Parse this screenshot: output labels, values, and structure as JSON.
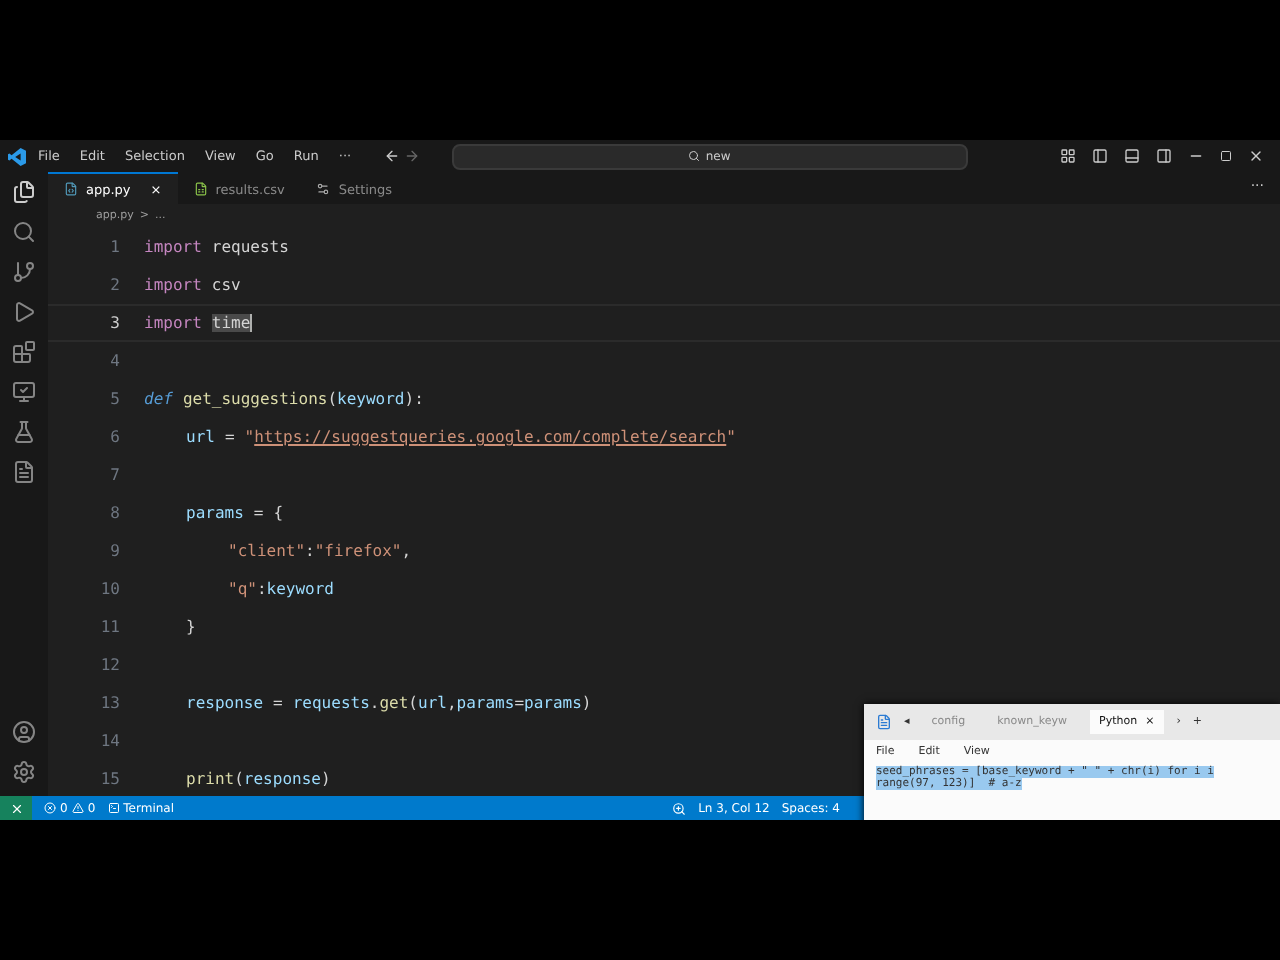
{
  "menu": [
    "File",
    "Edit",
    "Selection",
    "View",
    "Go",
    "Run",
    "···"
  ],
  "command_center": {
    "value": "new"
  },
  "tabs": [
    {
      "label": "app.py",
      "selected": true,
      "kind": "python",
      "close": "×"
    },
    {
      "label": "results.csv",
      "selected": false,
      "kind": "csv"
    },
    {
      "label": "Settings",
      "selected": false,
      "kind": "settings"
    }
  ],
  "editor_more": "···",
  "breadcrumb": [
    "app.py",
    ">",
    "..."
  ],
  "code": [
    {
      "number": "1",
      "current": false,
      "tokens": [
        {
          "kind": "kw",
          "t": "import"
        },
        {
          "kind": "plain",
          "t": "requests"
        }
      ]
    },
    {
      "number": "2",
      "current": false,
      "tokens": [
        {
          "kind": "kw",
          "t": "import"
        },
        {
          "kind": "plain",
          "t": "csv"
        }
      ]
    },
    {
      "number": "3",
      "current": true,
      "tokens": [
        {
          "kind": "kw",
          "t": "import"
        },
        {
          "kind": "match",
          "t": "time"
        }
      ]
    },
    {
      "number": "4",
      "current": false
    },
    {
      "number": "5",
      "current": false,
      "tokens": [
        {
          "kind": "def",
          "t": "def"
        },
        {
          "kind": "fn",
          "t": "get_suggestions"
        },
        {
          "kind": "glue",
          "t": "("
        },
        {
          "kind": "var",
          "t": "keyword"
        },
        {
          "kind": "glue",
          "t": "):"
        }
      ],
      "children": [
        {
          "number": "6",
          "current": false,
          "tokens": [
            {
              "kind": "var",
              "t": "url"
            },
            {
              "kind": "plain",
              "t": "="
            },
            {
              "kind": "str",
              "t": "\""
            },
            {
              "kind": "url",
              "t": "https://suggestqueries.google.com/complete/search"
            },
            {
              "kind": "str",
              "t": "\""
            }
          ]
        },
        {
          "number": "7",
          "current": false
        },
        {
          "number": "8",
          "current": false,
          "tokens": [
            {
              "kind": "var",
              "t": "params"
            },
            {
              "kind": "plain",
              "t": "="
            },
            {
              "kind": "plain",
              "t": "{"
            }
          ],
          "children": [
            {
              "number": "9",
              "current": false,
              "tokens": [
                {
                  "kind": "str",
                  "t": "\"client\""
                },
                {
                  "kind": "glue",
                  "t": ":"
                },
                {
                  "kind": "str",
                  "t": "\"firefox\""
                },
                {
                  "kind": "glue",
                  "t": ","
                }
              ]
            },
            {
              "number": "10",
              "current": false,
              "tokens": [
                {
                  "kind": "str",
                  "t": "\"q\""
                },
                {
                  "kind": "glue",
                  "t": ":"
                },
                {
                  "kind": "var",
                  "t": "keyword"
                }
              ]
            }
          ]
        },
        {
          "number": "11",
          "current": false,
          "tokens": [
            {
              "kind": "plain",
              "t": "}"
            }
          ]
        },
        {
          "number": "12",
          "current": false
        },
        {
          "number": "13",
          "current": false,
          "tokens": [
            {
              "kind": "var",
              "t": "response"
            },
            {
              "kind": "plain",
              "t": "="
            },
            {
              "kind": "var",
              "t": "requests"
            },
            {
              "kind": "glue",
              "t": "."
            },
            {
              "kind": "fn",
              "t": "get"
            },
            {
              "kind": "glue",
              "t": "("
            },
            {
              "kind": "var",
              "t": "url"
            },
            {
              "kind": "glue",
              "t": ","
            },
            {
              "kind": "var",
              "t": "params"
            },
            {
              "kind": "glue",
              "t": "="
            },
            {
              "kind": "var",
              "t": "params"
            },
            {
              "kind": "glue",
              "t": ")"
            }
          ]
        },
        {
          "number": "14",
          "current": false
        },
        {
          "number": "15",
          "current": false,
          "tokens": [
            {
              "kind": "fn",
              "t": "print"
            },
            {
              "kind": "glue",
              "t": "("
            },
            {
              "kind": "var",
              "t": "response"
            },
            {
              "kind": "glue",
              "t": ")"
            }
          ]
        }
      ]
    }
  ],
  "status_bar": {
    "errors": "0",
    "warnings": "0",
    "terminal": "Terminal",
    "position": "Ln 3, Col 12",
    "spaces": "Spaces: 4"
  },
  "notepad": {
    "tabs": [
      {
        "label": "config",
        "selected": false
      },
      {
        "label": "known_keyw",
        "selected": false
      },
      {
        "label": "Python",
        "selected": true
      }
    ],
    "close": "×",
    "prev": "◂",
    "next": "›",
    "add": "+",
    "menu": [
      "File",
      "Edit",
      "View"
    ],
    "lines": [
      "seed_phrases = [base_keyword + \" \" + chr(i) for i i",
      "range(97, 123)]  # a-z"
    ]
  }
}
